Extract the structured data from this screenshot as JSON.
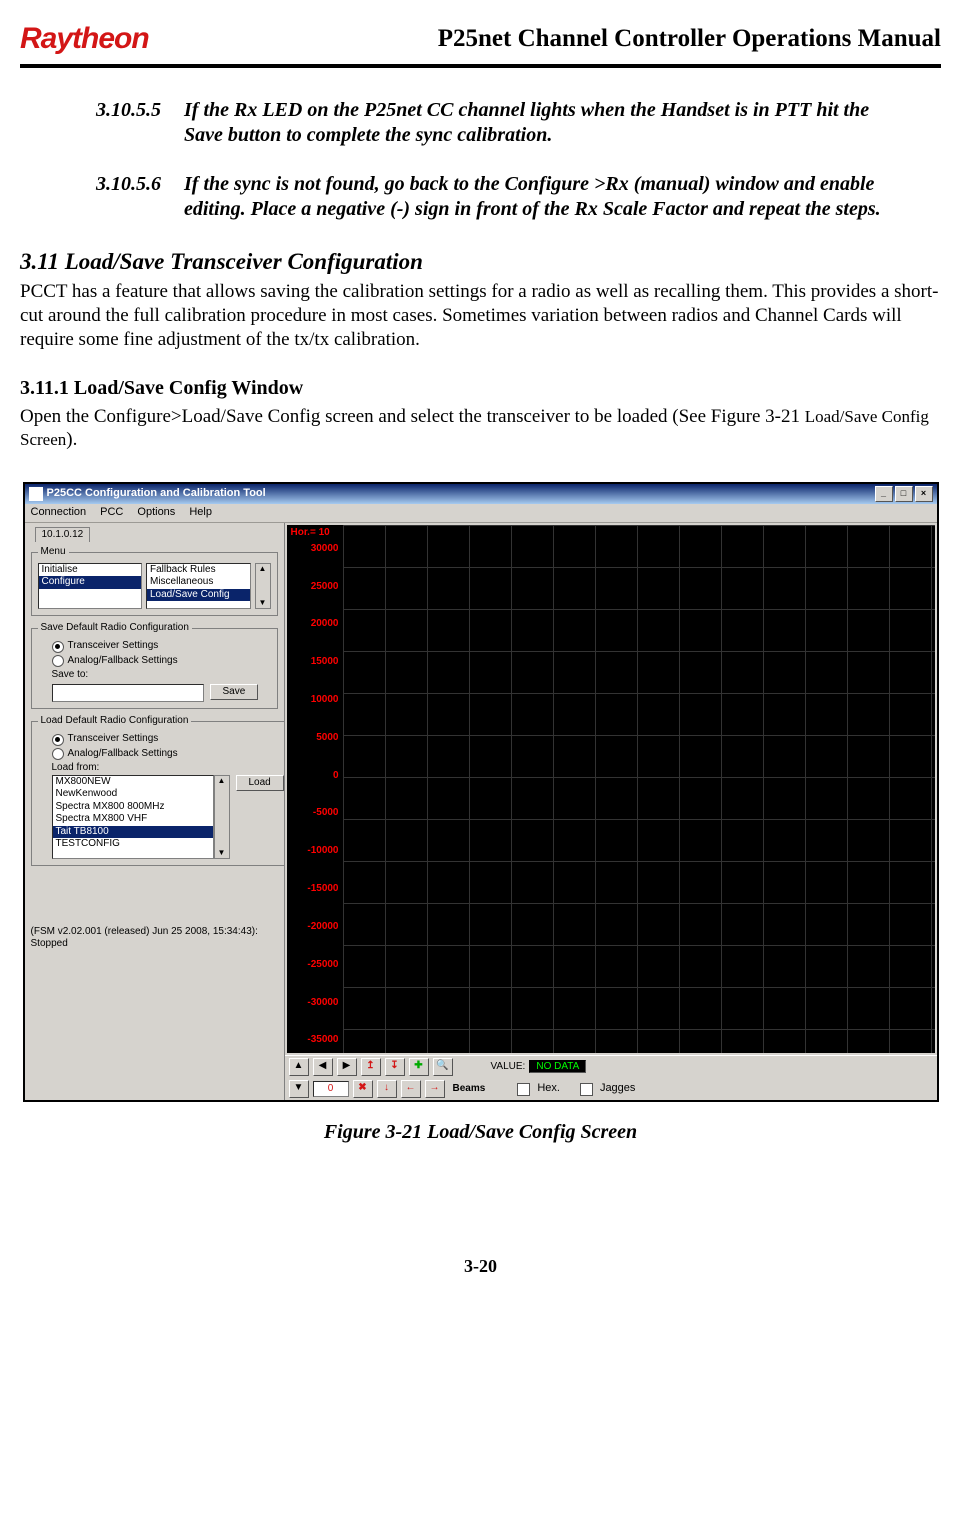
{
  "header": {
    "logo": "Raytheon",
    "doc_title": "P25net Channel Controller Operations Manual"
  },
  "steps": [
    {
      "num": "3.10.5.5",
      "text": "If the Rx LED on the P25net CC channel lights when the Handset is in PTT hit the Save button to complete the sync calibration."
    },
    {
      "num": "3.10.5.6",
      "text": "If the sync is not found, go back to the Configure >Rx (manual) window and enable editing. Place a negative (-) sign in front of the Rx Scale Factor and repeat the steps."
    }
  ],
  "section": {
    "num_title": "3.11 Load/Save Transceiver Configuration",
    "body": "PCCT has a feature that allows saving the calibration settings for a radio as well as recalling them. This provides a short-cut around the full calibration procedure in most cases. Sometimes variation between radios and Channel Cards will require some fine adjustment of the tx/tx calibration."
  },
  "subsection": {
    "num_title": "3.11.1  Load/Save Config Window",
    "body_pre": "Open the Configure>Load/Save Config screen and select the transceiver to be loaded (See Figure 3-21  ",
    "body_ref": "Load/Save Config Screen",
    "body_post": ")."
  },
  "figure_caption": "Figure 3-21  Load/Save Config Screen",
  "page_number": "3-20",
  "app": {
    "title": "P25CC Configuration and Calibration Tool",
    "menus": [
      "Connection",
      "PCC",
      "Options",
      "Help"
    ],
    "ip_tab": "10.1.0.12",
    "menu_group": {
      "legend": "Menu",
      "left_items": [
        "Initialise",
        "Configure"
      ],
      "left_selected": "Configure",
      "right_items": [
        "Fallback Rules",
        "Miscellaneous",
        "Load/Save Config"
      ],
      "right_selected": "Load/Save Config"
    },
    "save_group": {
      "legend": "Save Default Radio Configuration",
      "radio1": "Transceiver Settings",
      "radio2": "Analog/Fallback Settings",
      "save_to_label": "Save to:",
      "save_btn": "Save"
    },
    "load_group": {
      "legend": "Load Default Radio Configuration",
      "radio1": "Transceiver Settings",
      "radio2": "Analog/Fallback Settings",
      "load_from_label": "Load from:",
      "load_btn": "Load",
      "files": [
        "MX800NEW",
        "NewKenwood",
        "Spectra MX800 800MHz",
        "Spectra MX800 VHF",
        "Tait TB8100",
        "TESTCONFIG"
      ],
      "file_selected": "Tait TB8100"
    },
    "status_line": "(FSM v2.02.001 (released) Jun 25 2008, 15:34:43): Stopped",
    "plot": {
      "hor_label": "Hor.=  10",
      "yticks": [
        "30000",
        "25000",
        "20000",
        "15000",
        "10000",
        "5000",
        "0",
        "-5000",
        "-10000",
        "-15000",
        "-20000",
        "-25000",
        "-30000",
        "-35000"
      ]
    },
    "toolbar": {
      "value_label": "VALUE:",
      "value_text": "NO DATA",
      "num_val": "0",
      "beams": "Beams",
      "hex_label": "Hex.",
      "jagges_label": "Jagges"
    }
  },
  "chart_data": {
    "type": "line",
    "title": "",
    "xlabel": "",
    "ylabel": "",
    "ylim": [
      -35000,
      30000
    ],
    "yticks": [
      30000,
      25000,
      20000,
      15000,
      10000,
      5000,
      0,
      -5000,
      -10000,
      -15000,
      -20000,
      -25000,
      -30000,
      -35000
    ],
    "x_note": "Hor.= 10",
    "series": [
      {
        "name": "NO DATA",
        "values": []
      }
    ]
  }
}
